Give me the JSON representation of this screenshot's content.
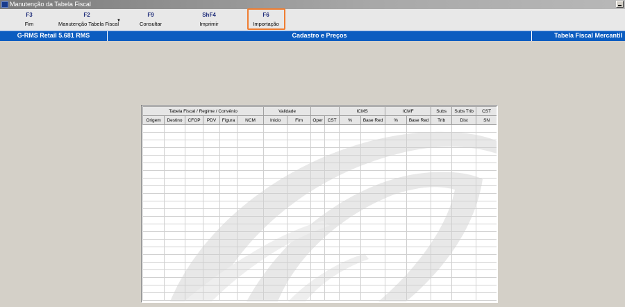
{
  "window": {
    "title": "Manutenção da Tabela Fiscal"
  },
  "toolbar": {
    "buttons": [
      {
        "key": "F3",
        "label": "Fim"
      },
      {
        "key": "F2",
        "label": "Manutenção Tabela Fiscal"
      },
      {
        "key": "F9",
        "label": "Consultar"
      },
      {
        "key": "ShF4",
        "label": "Imprimir"
      },
      {
        "key": "F6",
        "label": "Importação"
      }
    ],
    "highlighted": "F6",
    "highlight_color": "#ef7d31"
  },
  "banner": {
    "left": "G-RMS Retail 5.681 RMS",
    "center": "Cadastro e Preços",
    "right": "Tabela Fiscal Mercantil",
    "color": "#0b5cc0"
  },
  "grid": {
    "group_headers": [
      {
        "label": "Tabela Fiscal / Regime / Convênio"
      },
      {
        "label": "Validade"
      },
      {
        "label": ""
      },
      {
        "label": "ICMS"
      },
      {
        "label": "ICMF"
      },
      {
        "label": "Subs"
      },
      {
        "label": "Subs Trib"
      },
      {
        "label": "CST"
      }
    ],
    "columns": [
      "Origem",
      "Destino",
      "CFOP",
      "PDV",
      "Figura",
      "NCM",
      "Inicio",
      "Fim",
      "Oper",
      "CST",
      "%",
      "Base Red",
      "%",
      "Base Red",
      "Trib",
      "Dist",
      "SN"
    ]
  }
}
